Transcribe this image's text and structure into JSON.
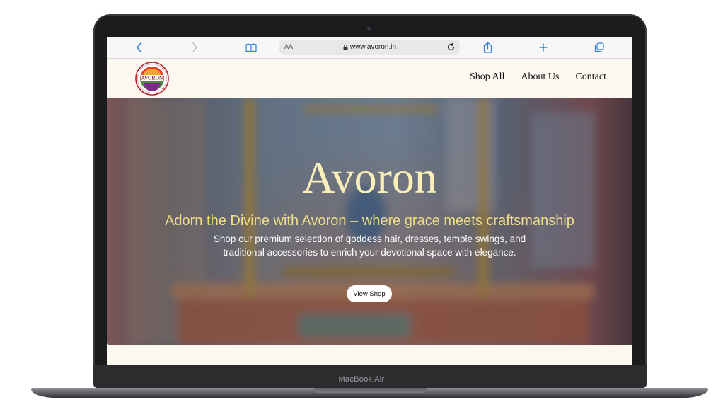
{
  "device": {
    "model_label": "MacBook Air"
  },
  "browser": {
    "text_size_label": "AA",
    "url": "www.avoron.in",
    "icons": [
      "back-icon",
      "forward-icon",
      "bookmarks-icon",
      "lock-icon",
      "reload-icon",
      "share-icon",
      "new-tab-icon",
      "tabs-icon"
    ]
  },
  "site": {
    "logo_text": "AVORON",
    "nav": [
      "Shop All",
      "About Us",
      "Contact"
    ]
  },
  "hero": {
    "title": "Avoron",
    "tagline": "Adorn the Divine with Avoron – where grace meets craftsmanship",
    "description": "Shop our premium selection of goddess hair, dresses, temple swings, and traditional accessories to enrich your devotional space with elegance.",
    "cta_label": "View Shop"
  },
  "colors": {
    "page_background": "#fdf8ef",
    "hero_title": "#fbefb9",
    "hero_tagline": "#f0dd8a",
    "link_blue": "#2f7de1",
    "laptop_frame": "#1c1c1e"
  }
}
